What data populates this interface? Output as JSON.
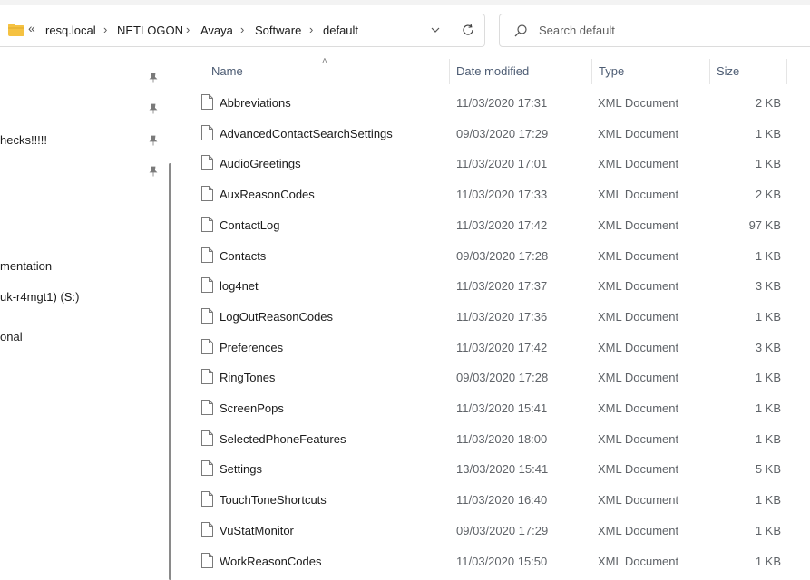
{
  "address": {
    "overflow": "«",
    "crumbs": [
      "resq.local",
      "NETLOGON",
      "Avaya",
      "Software",
      "default"
    ],
    "separator": "›"
  },
  "search": {
    "placeholder": "Search default"
  },
  "nav": {
    "items": [
      {
        "label": "hecks!!!!!"
      },
      {
        "label": "mentation"
      },
      {
        "label": "uk-r4mgt1) (S:)"
      },
      {
        "label": "onal"
      }
    ]
  },
  "columns": {
    "name": "Name",
    "date": "Date modified",
    "type": "Type",
    "size": "Size"
  },
  "files": [
    {
      "name": "Abbreviations",
      "date": "11/03/2020 17:31",
      "type": "XML Document",
      "size": "2 KB"
    },
    {
      "name": "AdvancedContactSearchSettings",
      "date": "09/03/2020 17:29",
      "type": "XML Document",
      "size": "1 KB"
    },
    {
      "name": "AudioGreetings",
      "date": "11/03/2020 17:01",
      "type": "XML Document",
      "size": "1 KB"
    },
    {
      "name": "AuxReasonCodes",
      "date": "11/03/2020 17:33",
      "type": "XML Document",
      "size": "2 KB"
    },
    {
      "name": "ContactLog",
      "date": "11/03/2020 17:42",
      "type": "XML Document",
      "size": "97 KB"
    },
    {
      "name": "Contacts",
      "date": "09/03/2020 17:28",
      "type": "XML Document",
      "size": "1 KB"
    },
    {
      "name": "log4net",
      "date": "11/03/2020 17:37",
      "type": "XML Document",
      "size": "3 KB"
    },
    {
      "name": "LogOutReasonCodes",
      "date": "11/03/2020 17:36",
      "type": "XML Document",
      "size": "1 KB"
    },
    {
      "name": "Preferences",
      "date": "11/03/2020 17:42",
      "type": "XML Document",
      "size": "3 KB"
    },
    {
      "name": "RingTones",
      "date": "09/03/2020 17:28",
      "type": "XML Document",
      "size": "1 KB"
    },
    {
      "name": "ScreenPops",
      "date": "11/03/2020 15:41",
      "type": "XML Document",
      "size": "1 KB"
    },
    {
      "name": "SelectedPhoneFeatures",
      "date": "11/03/2020 18:00",
      "type": "XML Document",
      "size": "1 KB"
    },
    {
      "name": "Settings",
      "date": "13/03/2020 15:41",
      "type": "XML Document",
      "size": "5 KB"
    },
    {
      "name": "TouchToneShortcuts",
      "date": "11/03/2020 16:40",
      "type": "XML Document",
      "size": "1 KB"
    },
    {
      "name": "VuStatMonitor",
      "date": "09/03/2020 17:29",
      "type": "XML Document",
      "size": "1 KB"
    },
    {
      "name": "WorkReasonCodes",
      "date": "11/03/2020 15:50",
      "type": "XML Document",
      "size": "1 KB"
    }
  ],
  "colors": {
    "folder": "#f5c242",
    "header_text": "#4d5c73",
    "secondary_text": "#5f6368"
  }
}
